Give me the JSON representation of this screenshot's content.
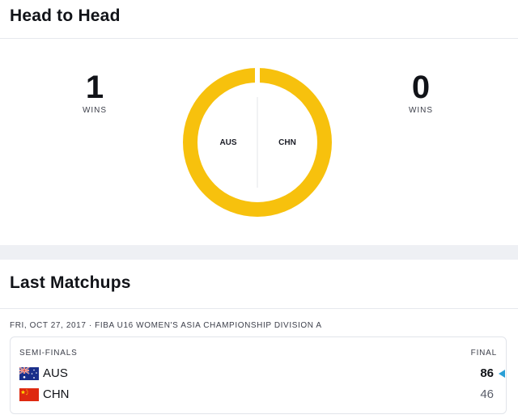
{
  "head_to_head": {
    "title": "Head to Head",
    "left_team": {
      "code": "AUS",
      "wins": "1",
      "wins_label": "WINS"
    },
    "right_team": {
      "code": "CHN",
      "wins": "0",
      "wins_label": "WINS"
    },
    "donut_share": {
      "left": 1,
      "right": 0
    }
  },
  "last_matchups": {
    "title": "Last Matchups",
    "match": {
      "meta": "FRI, OCT 27, 2017 · FIBA U16 WOMEN'S ASIA CHAMPIONSHIP DIVISION A",
      "round": "SEMI-FINALS",
      "status": "FINAL",
      "teams": [
        {
          "code": "AUS",
          "score": "86",
          "winner": true,
          "flag_icon": "australia-flag-icon"
        },
        {
          "code": "CHN",
          "score": "46",
          "winner": false,
          "flag_icon": "china-flag-icon"
        }
      ]
    }
  },
  "colors": {
    "accent": "#F7C10D",
    "winner_arrow": "#2A9FD6",
    "background": "#EEF0F4"
  }
}
